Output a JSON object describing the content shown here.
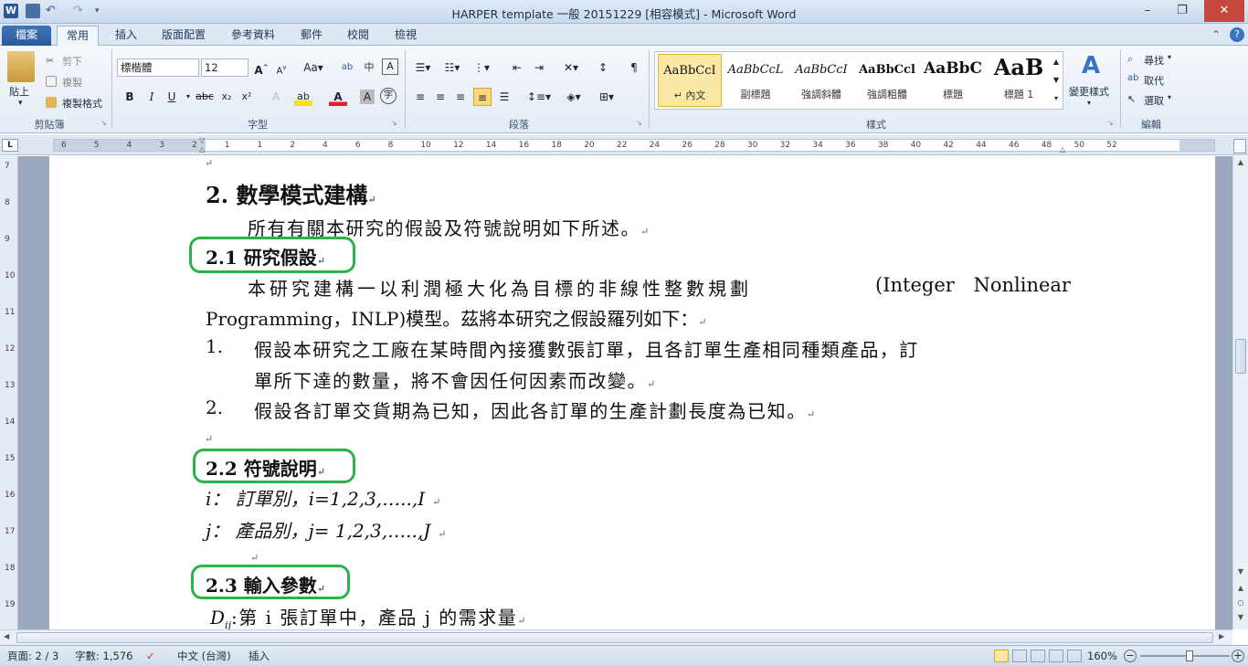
{
  "window": {
    "title": "HARPER template 一般 20151229 [相容模式] - Microsoft Word",
    "app_icon": "W"
  },
  "quick_access": {
    "save": "save-icon",
    "undo": "undo-icon",
    "redo": "redo-icon"
  },
  "tabs": {
    "file": "檔案",
    "home": "常用",
    "insert": "插入",
    "layout": "版面配置",
    "references": "參考資料",
    "mailings": "郵件",
    "review": "校閱",
    "view": "檢視"
  },
  "ribbon": {
    "clipboard": {
      "paste": "貼上",
      "cut": "剪下",
      "copy": "複製",
      "format_painter": "複製格式",
      "label": "剪貼簿"
    },
    "font": {
      "name": "標楷體",
      "size": "12",
      "label": "字型"
    },
    "paragraph": {
      "label": "段落"
    },
    "styles": {
      "label": "樣式",
      "items": [
        {
          "preview": "AaBbCcI",
          "name": "↵ 內文"
        },
        {
          "preview": "AaBbCcL",
          "name": "副標題"
        },
        {
          "preview": "AaBbCcI",
          "name": "強調斜體"
        },
        {
          "preview": "AaBbCcl",
          "name": "強調粗體"
        },
        {
          "preview": "AaBbC",
          "name": "標題"
        },
        {
          "preview": "AaB",
          "name": "標題 1"
        }
      ],
      "change_styles": "變更樣式"
    },
    "editing": {
      "find": "尋找",
      "replace": "取代",
      "select": "選取",
      "label": "編輯"
    }
  },
  "ruler": {
    "numbers": [
      "6",
      "5",
      "4",
      "3",
      "2",
      "1",
      "1",
      "2",
      "4",
      "6",
      "8",
      "10",
      "12",
      "14",
      "16",
      "18",
      "20",
      "22",
      "24",
      "26",
      "28",
      "30",
      "32",
      "34",
      "36",
      "38",
      "40",
      "42",
      "44",
      "46",
      "48",
      "50",
      "52"
    ],
    "vertical_numbers": [
      "7",
      "8",
      "9",
      "10",
      "11",
      "12",
      "13",
      "14",
      "15",
      "16",
      "17",
      "18",
      "19"
    ]
  },
  "document": {
    "top_mark": "↵",
    "h2": "2.  數學模式建構",
    "intro": "所有有關本研究的假設及符號說明如下所述。",
    "s21_title": "2.1  研究假設",
    "s21_p1_line1_a": "本研究建構一以利潤極大化為目標的非線性整數規劃",
    "s21_p1_line1_b": "(Integer Nonlinear",
    "s21_p1_line2": "Programming，INLP)模型。茲將本研究之假設羅列如下：",
    "item1_num": "1.",
    "item1_line1": "假設本研究之工廠在某時間內接獲數張訂單，且各訂單生產相同種類產品，訂",
    "item1_line2": "單所下達的數量，將不會因任何因素而改變。",
    "item2_num": "2.",
    "item2_line1": "假設各訂單交貨期為已知，因此各訂單的生產計劃長度為已知。",
    "empty_mark": "↵",
    "s22_title": "2.2  符號說明",
    "sym_i": "i：  訂單別，i=1,2,3,…..,I",
    "sym_j": "j：  產品別，j= 1,2,3,…..,J",
    "s23_title": "2.3 輸入參數",
    "param_sym": "D",
    "param_sub": "ij",
    "param_text": ":第 i 張訂單中，產品 j 的需求量"
  },
  "status": {
    "page": "頁面: 2 / 3",
    "words": "字數: 1,576",
    "language": "中文 (台灣)",
    "mode": "插入",
    "zoom": "160%"
  },
  "colors": {
    "highlight": "#2bb34a",
    "file_tab": "#2a5a9a",
    "close": "#c4483c"
  }
}
